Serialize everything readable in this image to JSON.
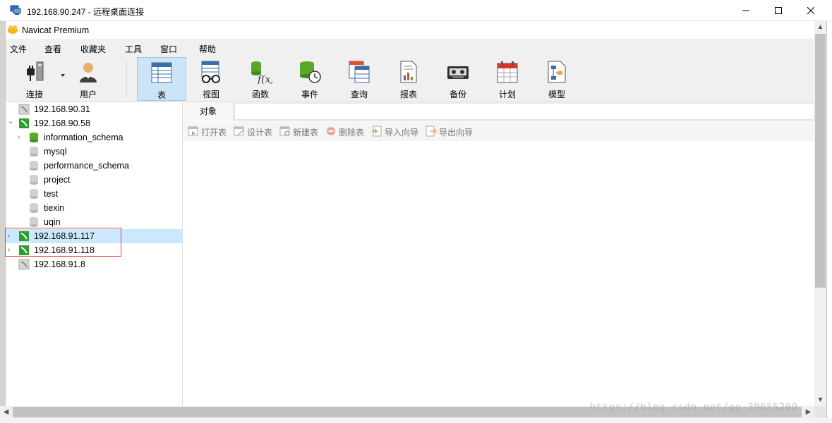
{
  "rdp_window": {
    "title": "192.168.90.247 - 远程桌面连接",
    "controls": {
      "minimize": "—",
      "maximize": "☐",
      "close": "✕"
    }
  },
  "app": {
    "title": "Navicat Premium"
  },
  "menu": [
    "文件",
    "查看",
    "收藏夹",
    "工具",
    "窗口",
    "帮助"
  ],
  "toolbar": [
    {
      "label": "连接",
      "icon": "plug-icon"
    },
    {
      "label": "用户",
      "icon": "user-icon"
    },
    {
      "label": "表",
      "icon": "table-icon",
      "active": true
    },
    {
      "label": "视图",
      "icon": "view-icon"
    },
    {
      "label": "函数",
      "icon": "function-icon"
    },
    {
      "label": "事件",
      "icon": "event-icon"
    },
    {
      "label": "查询",
      "icon": "query-icon"
    },
    {
      "label": "报表",
      "icon": "report-icon"
    },
    {
      "label": "备份",
      "icon": "backup-icon"
    },
    {
      "label": "计划",
      "icon": "schedule-icon"
    },
    {
      "label": "模型",
      "icon": "model-icon"
    }
  ],
  "tree": [
    {
      "label": "192.168.90.31",
      "kind": "connection-closed",
      "expander": ""
    },
    {
      "label": "192.168.90.58",
      "kind": "connection-open",
      "expander": "⌄"
    },
    {
      "label": "information_schema",
      "kind": "db-open",
      "expander": "›"
    },
    {
      "label": "mysql",
      "kind": "db",
      "expander": ""
    },
    {
      "label": "performance_schema",
      "kind": "db",
      "expander": ""
    },
    {
      "label": "project",
      "kind": "db",
      "expander": ""
    },
    {
      "label": "test",
      "kind": "db",
      "expander": ""
    },
    {
      "label": "tiexin",
      "kind": "db",
      "expander": ""
    },
    {
      "label": "uqin",
      "kind": "db",
      "expander": ""
    },
    {
      "label": "192.168.91.117",
      "kind": "connection-open",
      "expander": "›",
      "selected": true
    },
    {
      "label": "192.168.91.118",
      "kind": "connection-open",
      "expander": "›"
    },
    {
      "label": "192.168.91.8",
      "kind": "connection-closed",
      "expander": ""
    }
  ],
  "tabs": {
    "objects": "对象"
  },
  "object_toolbar": [
    {
      "label": "打开表",
      "icon": "open-table-icon"
    },
    {
      "label": "设计表",
      "icon": "design-table-icon"
    },
    {
      "label": "新建表",
      "icon": "new-table-icon"
    },
    {
      "label": "删除表",
      "icon": "delete-table-icon"
    },
    {
      "label": "导入向导",
      "icon": "import-wizard-icon"
    },
    {
      "label": "导出向导",
      "icon": "export-wizard-icon"
    }
  ],
  "watermark": "https://blog.csdn.net/qq_39655200",
  "colors": {
    "selection": "#cce8ff",
    "active_tool": "#cce4f7",
    "connection_green": "#2e9c2e",
    "highlight_box": "#e0403a"
  }
}
